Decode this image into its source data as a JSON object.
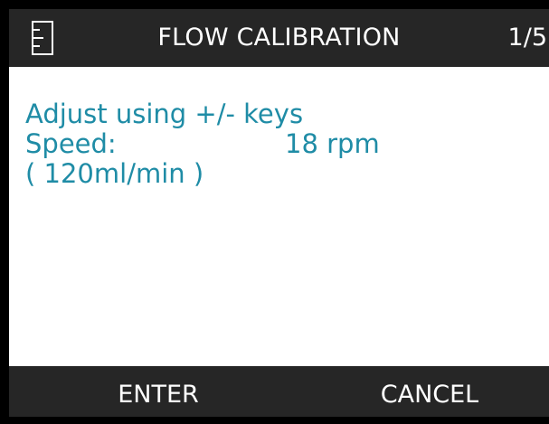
{
  "header": {
    "icon": "flow-calibration-icon",
    "title": "FLOW CALIBRATION",
    "page_indicator": "1/5"
  },
  "content": {
    "instruction": "Adjust using +/- keys",
    "speed_label": "Speed:",
    "speed_value": "18 rpm",
    "flow_rate": "( 120ml/min )"
  },
  "footer": {
    "enter_label": "ENTER",
    "cancel_label": "CANCEL"
  },
  "colors": {
    "header_bg": "#262626",
    "header_text": "#ffffff",
    "content_text": "#1f8ca6",
    "screen_bg": "#ffffff",
    "bezel": "#000000"
  }
}
